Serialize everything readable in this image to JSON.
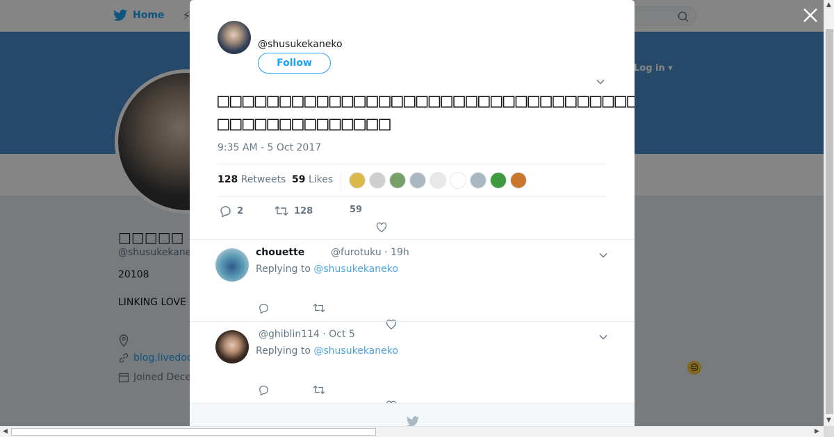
{
  "nav": {
    "home_label": "Home",
    "login_label": "Log in"
  },
  "profile": {
    "name": "□□□□□",
    "handle": "@shusukekane",
    "count": "20108",
    "bio": "LINKING LOVE",
    "link": "blog.livedoo",
    "joined": "Joined Dece"
  },
  "tweet": {
    "handle": "@shusukekaneko",
    "follow_label": "Follow",
    "text_line1": "□□□□□□□□□□□□□□□□□□□□□□□□□□□□□□□□□□□□□□□□□□□□□□☆□□□□□□",
    "text_line2": "□□□□□□□□□□□□□□",
    "timestamp": "9:35 AM - 5 Oct 2017",
    "retweets_count": "128",
    "retweets_label": "Retweets",
    "likes_count": "59",
    "likes_label": "Likes",
    "reply_count": "2",
    "retweet_count": "128",
    "like_count": "59"
  },
  "likers": [
    {
      "icon": "coin-avatar",
      "color": "#d9b94a"
    },
    {
      "icon": "sketch-avatar",
      "color": "#cfcfcf"
    },
    {
      "icon": "anime-avatar",
      "color": "#7aa06a"
    },
    {
      "icon": "default-avatar",
      "color": "#aab8c2"
    },
    {
      "icon": "drawing-avatar",
      "color": "#e8e8e8"
    },
    {
      "icon": "face-drawing-avatar",
      "color": "#ffffff"
    },
    {
      "icon": "default-avatar",
      "color": "#aab8c2"
    },
    {
      "icon": "green-avatar",
      "color": "#3f9a3f"
    },
    {
      "icon": "food-avatar",
      "color": "#c9772f"
    }
  ],
  "replies": [
    {
      "name": "chouette",
      "meta": "@furotuku · 19h",
      "replying_prefix": "Replying to",
      "replying_to": "@shusukekaneko",
      "avatar_color": "#5b9bb5"
    },
    {
      "name": "",
      "meta": "@ghiblin114 · Oct 5",
      "replying_prefix": "Replying to",
      "replying_to": "@shusukekaneko",
      "avatar_color": "#3a2a22"
    }
  ],
  "colors": {
    "brand": "#1da1f2",
    "banner": "#4a8ccc",
    "text_secondary": "#657786"
  }
}
